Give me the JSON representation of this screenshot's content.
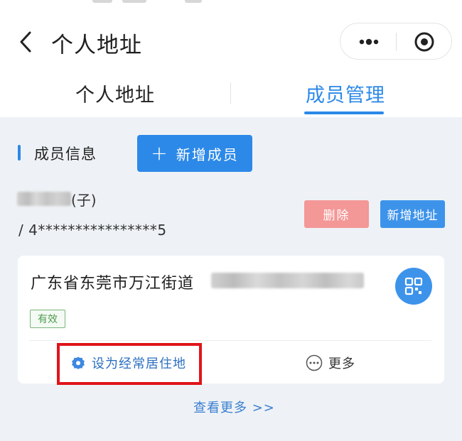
{
  "header": {
    "title": "个人地址"
  },
  "tabs": [
    {
      "label": "个人地址"
    },
    {
      "label": "成员管理"
    }
  ],
  "members_section": {
    "title": "成员信息",
    "add_member_label": "新增成员"
  },
  "member": {
    "relation": "(子)",
    "id_masked": "/ 4****************5",
    "delete_label": "删除",
    "add_address_label": "新增地址"
  },
  "address": {
    "text": "广东省东莞市万江街道",
    "status": "有效",
    "set_residence_label": "设为经常居住地",
    "more_label": "更多"
  },
  "footer": {
    "view_more_label": "查看更多 >>"
  },
  "colors": {
    "accent": "#2c89e8",
    "delete": "#f49797",
    "valid_green": "#4f9a4f",
    "highlight_red": "#e0141b"
  }
}
